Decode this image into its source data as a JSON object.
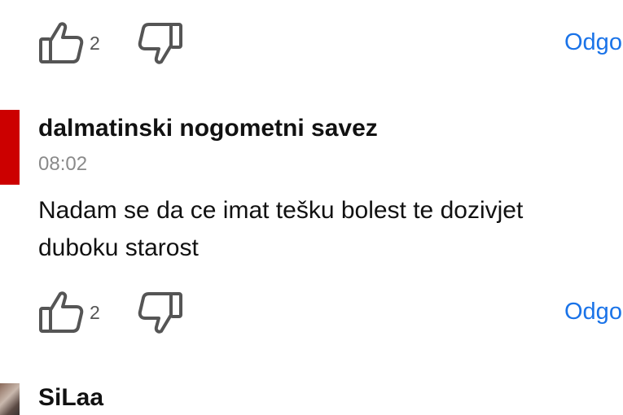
{
  "colors": {
    "accent_link": "#1a73e8",
    "avatar_red": "#cc0000",
    "timestamp_gray": "#8a8a8a",
    "icon_gray": "#555555"
  },
  "comments": [
    {
      "likes": "2",
      "reply_label": "Odgo",
      "icons": [
        "thumbs-up-icon",
        "thumbs-down-icon"
      ]
    },
    {
      "author": "dalmatinski nogometni savez",
      "time": "08:02",
      "text_line1": "Nadam se da ce imat tešku bolest te dozivjet",
      "text_line2": "duboku starost",
      "likes": "2",
      "reply_label": "Odgo",
      "icons": [
        "thumbs-up-icon",
        "thumbs-down-icon"
      ]
    },
    {
      "author": "SiLaa"
    }
  ]
}
